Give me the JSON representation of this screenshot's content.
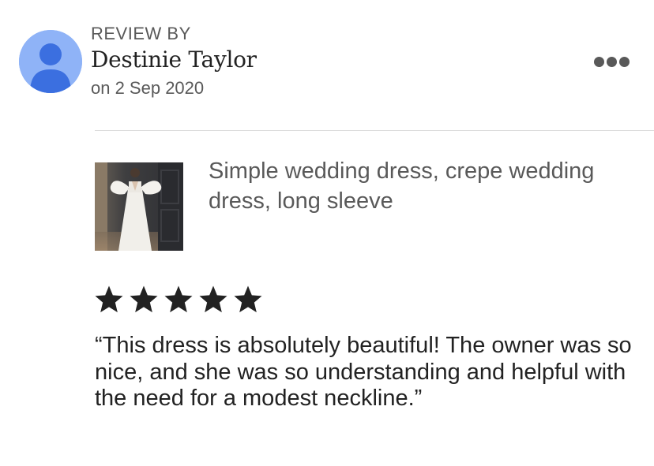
{
  "review": {
    "heading": "REVIEW BY",
    "reviewer_name": "Destinie Taylor",
    "date": "on 2 Sep 2020",
    "rating": 5,
    "max_rating": 5,
    "text": "“This dress is absolutely beautiful! The owner was so nice, and she was so understanding and helpful with the need for a modest neckline.”"
  },
  "product": {
    "title": "Simple wedding dress, crepe wedding dress, long sleeve"
  },
  "icons": {
    "avatar": "default-user-avatar",
    "more": "more-options-dots",
    "star": "star-filled"
  },
  "colors": {
    "avatar_bg": "#8fb3f7",
    "avatar_figure": "#3b6fe0",
    "star": "#222222",
    "muted_text": "#595959",
    "divider": "#dddddd"
  }
}
